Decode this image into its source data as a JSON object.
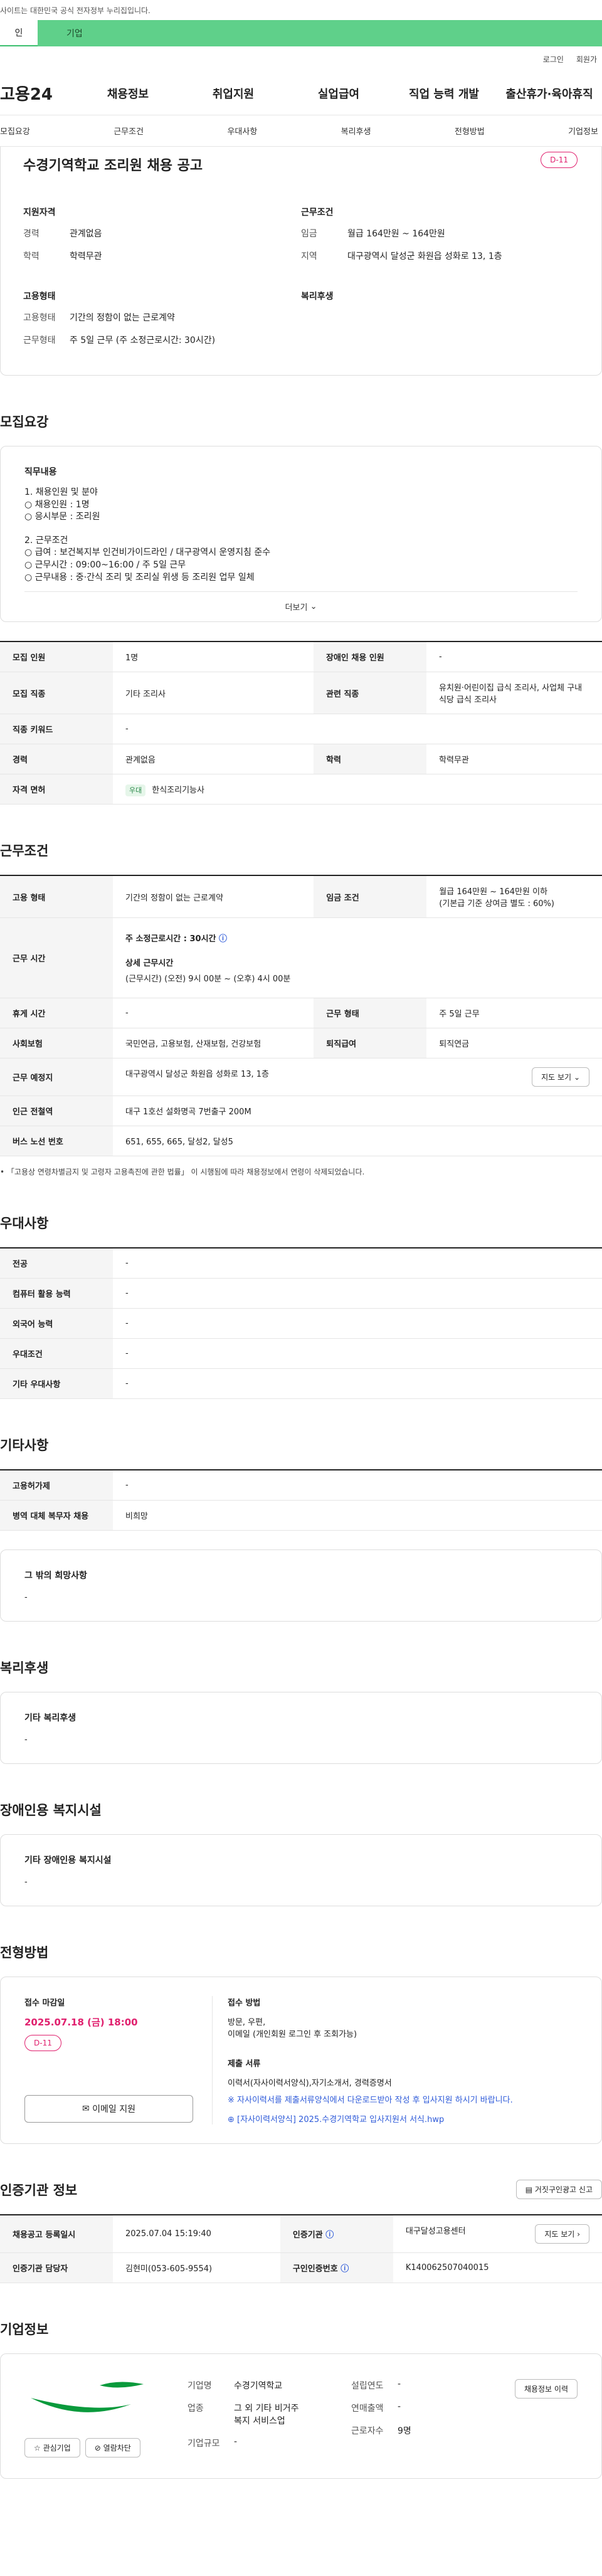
{
  "topbar": {
    "notice": "사이트는 대한민국 공식 전자정부 누리집입니다."
  },
  "tabs": {
    "personal": "인",
    "company": "기업"
  },
  "util": {
    "login": "로그인",
    "join": "회원가"
  },
  "gnb": {
    "logo": "고용24",
    "items": [
      "채용정보",
      "취업지원",
      "실업급여",
      "직업 능력 개발",
      "출산휴가·육아휴직"
    ]
  },
  "subnav": [
    "모집요강",
    "근무조건",
    "우대사항",
    "복리후생",
    "전형방법",
    "기업정보"
  ],
  "summary": {
    "title": "수경기역학교 조리원 채용 공고",
    "dday": "D-11",
    "qual_title": "지원자격",
    "career_k": "경력",
    "career_v": "관계없음",
    "edu_k": "학력",
    "edu_v": "학력무관",
    "cond_title": "근무조건",
    "wage_k": "임금",
    "wage_v": "월급 164만원 ~ 164만원",
    "area_k": "지역",
    "area_v": "대구광역시 달성군 화원읍 성화로 13, 1층",
    "emp_title": "고용형태",
    "emptype_k": "고용형태",
    "emptype_v": "기간의 정함이 없는 근로계약",
    "worktype_k": "근무형태",
    "worktype_v": "주 5일 근무 (주 소정근로시간: 30시간)",
    "welfare_title": "복리후생"
  },
  "recruit": {
    "title": "모집요강",
    "job_title": "직무내용",
    "lines": [
      "1. 채용인원 및 분야",
      "○ 채용인원 : 1명",
      "○ 응시부문 : 조리원",
      "",
      "2. 근무조건",
      "○ 급여 : 보건복지부 인건비가이드라인 / 대구광역시 운영지침 준수",
      "○ 근무시간 : 09:00~16:00 / 주 5일 근무",
      "○ 근무내용 : 중·간식 조리 및 조리실 위생 등 조리원 업무 일체"
    ],
    "more": "더보기",
    "table": {
      "r1": [
        "모집 인원",
        "1명",
        "장애인 채용 인원",
        "-"
      ],
      "r2": [
        "모집 직종",
        "기타 조리사",
        "관련 직종",
        "유치원·어린이집 급식 조리사, 사업체 구내식당 급식 조리사"
      ],
      "r3": [
        "직종 키워드",
        "-"
      ],
      "r4": [
        "경력",
        "관계없음",
        "학력",
        "학력무관"
      ],
      "r5_k": "자격 면허",
      "r5_badge": "우대",
      "r5_v": "한식조리기능사"
    }
  },
  "conditions": {
    "title": "근무조건",
    "emp_k": "고용 형태",
    "emp_v": "기간의 정함이 없는 근로계약",
    "wage_k": "임금 조건",
    "wage_v1": "월급 164만원 ~ 164만원 이하",
    "wage_v2": "(기본급 기준 상여금 별도 : 60%)",
    "time_k": "근무 시간",
    "time_v1": "주 소정근로시간 : 30시간",
    "time_v2": "상세 근무시간",
    "time_v3": "(근무시간) (오전) 9시 00분 ~ (오후) 4시 00분",
    "rest_k": "휴게 시간",
    "rest_v": "-",
    "form_k": "근무 형태",
    "form_v": "주 5일 근무",
    "ins_k": "사회보험",
    "ins_v": "국민연금, 고용보험, 산재보험, 건강보험",
    "ret_k": "퇴직급여",
    "ret_v": "퇴직연금",
    "place_k": "근무 예정지",
    "place_v": "대구광역시 달성군 화원읍 성화로 13, 1층",
    "map_btn": "지도 보기",
    "station_k": "인근 전철역",
    "station_v": "대구 1호선 설화명곡 7번출구 200M",
    "bus_k": "버스 노선 번호",
    "bus_v": "651, 655, 665, 달성2, 달성5",
    "note": "「고용상 연령차별금지 및 고령자 고용촉진에 관한 법률」 이 시행됨에 따라 채용정보에서 연령이 삭제되었습니다."
  },
  "preference": {
    "title": "우대사항",
    "rows": [
      [
        "전공",
        "-"
      ],
      [
        "컴퓨터 활용 능력",
        "-"
      ],
      [
        "외국어 능력",
        "-"
      ],
      [
        "우대조건",
        "-"
      ],
      [
        "기타 우대사항",
        "-"
      ]
    ]
  },
  "etc": {
    "title": "기타사항",
    "rows": [
      [
        "고용허가제",
        "-"
      ],
      [
        "병역 대체 복무자 채용",
        "비희망"
      ]
    ],
    "extra_title": "그 밖의 희망사항",
    "extra_v": "-"
  },
  "welfare": {
    "title": "복리후생",
    "box_title": "기타 복리후생",
    "box_v": "-"
  },
  "facility": {
    "title": "장애인용 복지시설",
    "box_title": "기타 장애인용 복지시설",
    "box_v": "-"
  },
  "process": {
    "title": "전형방법",
    "deadline_k": "접수 마감일",
    "deadline_v": "2025.07.18 (금) 18:00",
    "dday": "D-11",
    "email_btn": "이메일 지원",
    "method_k": "접수 방법",
    "method_v1": "방문, 우편,",
    "method_v2": "이메일 (개인회원 로그인 후 조회가능)",
    "docs_k": "제출 서류",
    "docs_v1": "이력서(자사이력서양식),자기소개서, 경력증명서",
    "docs_v2": "※ 자사이력서를 제출서류양식에서 다운로드받아 작성 후 입사지원 하시기 바랍니다.",
    "file": "[자사이력서양식] 2025.수경기역학교 입사지원서 서식.hwp"
  },
  "agency": {
    "title": "인증기관 정보",
    "report_btn": "거짓구인광고 신고",
    "reg_k": "채용공고 등록일시",
    "reg_v": "2025.07.04 15:19:40",
    "org_k": "인증기관",
    "org_v": "대구달성고용센터",
    "map_btn": "지도 보기",
    "mgr_k": "인증기관 담당자",
    "mgr_v": "김현미(053-605-9554)",
    "id_k": "구인인증번호",
    "id_v": "K140062507040015"
  },
  "company": {
    "title": "기업정보",
    "fav_btn": "관심기업",
    "view_btn": "열람차단",
    "history_btn": "채용정보 이력",
    "name_k": "기업명",
    "name_v": "수경기역학교",
    "ind_k": "업종",
    "ind_v1": "그 외 기타 비거주",
    "ind_v2": "복지 서비스업",
    "size_k": "기업규모",
    "size_v": "-",
    "est_k": "설립연도",
    "est_v": "-",
    "sales_k": "연매출액",
    "sales_v": "-",
    "emp_k": "근로자수",
    "emp_v": "9명"
  }
}
